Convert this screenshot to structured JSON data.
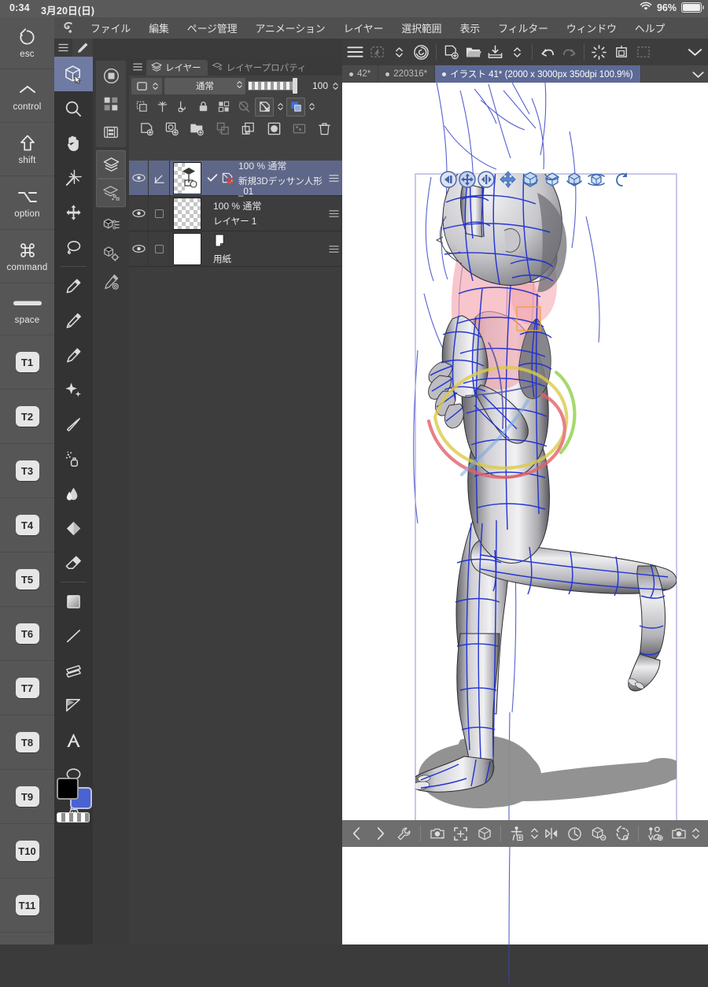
{
  "statusbar": {
    "clock": "0:34",
    "date": "3月20日(日)",
    "battery_percent": "96%",
    "wifi_icon": "wifi-icon",
    "battery_icon": "battery-icon"
  },
  "menubar": {
    "app_icon": "clip-studio-paint-icon",
    "items": [
      {
        "label": "ファイル"
      },
      {
        "label": "編集"
      },
      {
        "label": "ページ管理"
      },
      {
        "label": "アニメーション"
      },
      {
        "label": "レイヤー"
      },
      {
        "label": "選択範囲"
      },
      {
        "label": "表示"
      },
      {
        "label": "フィルター"
      },
      {
        "label": "ウィンドウ"
      },
      {
        "label": "ヘルプ"
      }
    ]
  },
  "keyrail": {
    "modifiers": [
      {
        "label": "esc",
        "icon": "undo-circle-icon"
      },
      {
        "label": "control",
        "icon": "chevron-up-icon"
      },
      {
        "label": "shift",
        "icon": "shift-arrow-icon"
      },
      {
        "label": "option",
        "icon": "option-alt-icon"
      },
      {
        "label": "command",
        "icon": "command-icon"
      },
      {
        "label": "space",
        "icon": "spacebar-icon"
      }
    ],
    "tkeys": [
      "T1",
      "T2",
      "T3",
      "T4",
      "T5",
      "T6",
      "T7",
      "T8",
      "T9",
      "T10",
      "T11"
    ]
  },
  "toolcol": {
    "menu_icon": "hamburger-icon",
    "pen_tab_icon": "pen-icon",
    "tools": [
      {
        "name": "3d-object-tool",
        "selected": true
      },
      {
        "name": "zoom-tool",
        "selected": false
      },
      {
        "name": "hand-tool",
        "selected": false
      },
      {
        "name": "magic-wand-tool",
        "selected": false
      },
      {
        "name": "move-tool",
        "selected": false
      },
      {
        "name": "lasso-select-tool",
        "selected": false
      },
      {
        "name": "pencil-tool",
        "selected": false
      },
      {
        "name": "dip-pen-tool",
        "selected": false
      },
      {
        "name": "brush-tool",
        "selected": false
      },
      {
        "name": "decoration-tool",
        "selected": false
      },
      {
        "name": "blend-tool",
        "selected": false
      },
      {
        "name": "airbrush-tool",
        "selected": false
      },
      {
        "name": "watercolor-tool",
        "selected": false
      },
      {
        "name": "fill-tool",
        "selected": false
      },
      {
        "name": "eraser-tool",
        "selected": false
      },
      {
        "name": "gradient-tool",
        "selected": false
      },
      {
        "name": "line-tool",
        "selected": false
      },
      {
        "name": "ruler-tool",
        "selected": false
      },
      {
        "name": "perspective-tool",
        "selected": false
      },
      {
        "name": "text-tool",
        "selected": false
      },
      {
        "name": "balloon-tool",
        "selected": false
      },
      {
        "name": "correct-line-tool",
        "selected": false
      }
    ],
    "colors": {
      "foreground": "#000000",
      "background": "#4a63d0",
      "transparent_swatch": "transparent-color-icon"
    }
  },
  "dockcol": {
    "groups": [
      {
        "items": [
          {
            "name": "navigator-icon",
            "active": false
          },
          {
            "name": "subtool-detail-icon",
            "active": false
          },
          {
            "name": "timeline-icon",
            "active": false
          }
        ]
      },
      {
        "items": [
          {
            "name": "layer-palette-icon",
            "active": true
          },
          {
            "name": "layer-property-icon",
            "active": true
          }
        ]
      },
      {
        "items": [
          {
            "name": "3d-object-list-icon",
            "active": false
          },
          {
            "name": "3d-object-settings-icon",
            "active": false
          },
          {
            "name": "quick-access-icon",
            "active": false
          }
        ]
      }
    ]
  },
  "layer_palette": {
    "menu_icon": "hamburger-icon",
    "tabs": [
      {
        "label": "レイヤー",
        "icon": "layers-stack-icon",
        "active": true
      },
      {
        "label": "レイヤープロパティ",
        "icon": "layer-property-icon",
        "active": false
      }
    ],
    "controls": {
      "mask_mode_icon": "mask-mode-icon",
      "blend_mode": "通常",
      "opacity": "100",
      "opacity_slider_icon": "opacity-slider"
    },
    "toggles": [
      {
        "name": "clip-to-layer-below-icon"
      },
      {
        "name": "layer-mask-icon"
      },
      {
        "name": "ruler-lock-icon"
      },
      {
        "name": "lock-layer-icon"
      },
      {
        "name": "lock-transparent-pixels-icon"
      },
      {
        "name": "draft-layer-icon"
      },
      {
        "name": "exclude-from-export-icon"
      },
      {
        "name": "palette-color-icon"
      }
    ],
    "actions": [
      {
        "name": "new-raster-layer-icon"
      },
      {
        "name": "new-tone-layer-icon"
      },
      {
        "name": "new-folder-icon"
      },
      {
        "name": "transfer-down-icon"
      },
      {
        "name": "merge-down-icon"
      },
      {
        "name": "create-mask-icon"
      },
      {
        "name": "layer-color-icon"
      },
      {
        "name": "delete-layer-icon"
      }
    ],
    "layers": [
      {
        "visible": true,
        "selected": true,
        "has_draw_icon": true,
        "checked": true,
        "no_export": true,
        "opacity_mode": "100 %  通常",
        "name": "新規3Dデッサン人形_01",
        "thumb": "3d-model-thumb",
        "handle_icon": "layer-menu-icon"
      },
      {
        "visible": true,
        "selected": false,
        "has_draw_icon": false,
        "checked": false,
        "no_export": false,
        "opacity_mode": "100 %  通常",
        "name": "レイヤー 1",
        "thumb": "transparent-thumb",
        "handle_icon": "layer-menu-icon"
      },
      {
        "visible": true,
        "selected": false,
        "has_draw_icon": false,
        "checked": false,
        "no_export": false,
        "opacity_mode": "",
        "name": "用紙",
        "thumb": "paper-thumb",
        "handle_icon": "layer-menu-icon"
      }
    ]
  },
  "canvas": {
    "toolbar": [
      {
        "name": "hamburger-menu-icon",
        "dim": false
      },
      {
        "name": "auto-select-icon",
        "dim": true
      },
      {
        "name": "stepper-icon",
        "dim": false
      },
      {
        "name": "spiral-rotate-icon",
        "dim": false
      },
      {
        "name": "new-canvas-icon",
        "dim": false
      },
      {
        "name": "open-file-icon",
        "dim": false
      },
      {
        "name": "save-file-icon",
        "dim": false
      },
      {
        "name": "save-stepper-icon",
        "dim": false
      },
      {
        "name": "undo-icon",
        "dim": false
      },
      {
        "name": "redo-icon",
        "dim": true
      },
      {
        "name": "clear-icon",
        "dim": false
      },
      {
        "name": "fill-selection-icon",
        "dim": false
      },
      {
        "name": "deselect-icon",
        "dim": true
      },
      {
        "name": "expand-toolbar-caret-icon",
        "dim": false
      },
      {
        "name": "collapse-panel-icon",
        "dim": false
      }
    ],
    "tabs": [
      {
        "label": "42*",
        "active": false
      },
      {
        "label": "220316*",
        "active": false
      },
      {
        "label": "イラスト 41* (2000 x 3000px 350dpi 100.9%)",
        "active": true
      }
    ],
    "tab_caret_icon": "chevron-down-icon",
    "bottom_toolbar": [
      {
        "name": "prev-pose-icon"
      },
      {
        "name": "next-pose-icon"
      },
      {
        "name": "3d-settings-wrench-icon"
      },
      {
        "name": "register-camera-icon"
      },
      {
        "name": "fit-camera-icon"
      },
      {
        "name": "reset-camera-icon"
      },
      {
        "name": "add-figure-icon"
      },
      {
        "name": "figure-stepper-icon"
      },
      {
        "name": "flip-horizontal-icon"
      },
      {
        "name": "reset-pose-icon"
      },
      {
        "name": "reset-model-icon"
      },
      {
        "name": "reset-rotation-icon"
      },
      {
        "name": "register-pose-icon"
      },
      {
        "name": "register-material-icon"
      },
      {
        "name": "material-stepper-icon"
      }
    ],
    "gizmo": [
      {
        "name": "move-camera-left-icon"
      },
      {
        "name": "move-plane-icon"
      },
      {
        "name": "move-depth-icon"
      },
      {
        "name": "move-free-icon"
      },
      {
        "name": "rotate-vertical-icon"
      },
      {
        "name": "rotate-horizontal-icon"
      },
      {
        "name": "rotate-tilt-icon"
      },
      {
        "name": "rotate-ground-icon"
      },
      {
        "name": "undo-pose-icon"
      }
    ],
    "model": {
      "name": "新規3Dデッサン人形_01",
      "type": "3d-drawing-figure",
      "wireframe_color": "#1d2ed2",
      "highlight_color": "#f0a0a8",
      "manipulator_ring_colors": [
        "#e4606a",
        "#8fd04a",
        "#d8c84a",
        "#6aa8e0"
      ]
    }
  }
}
